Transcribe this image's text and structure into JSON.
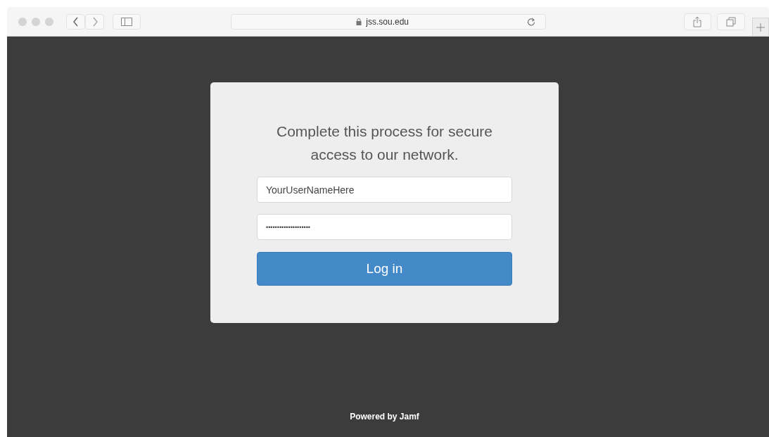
{
  "browser": {
    "url": "jss.sou.edu"
  },
  "login": {
    "heading": "Complete this process for secure access to our network.",
    "username": {
      "value": "YourUserNameHere"
    },
    "password": {
      "value": "••••••••••••••••••••"
    },
    "button": "Log in"
  },
  "footer": "Powered by Jamf"
}
